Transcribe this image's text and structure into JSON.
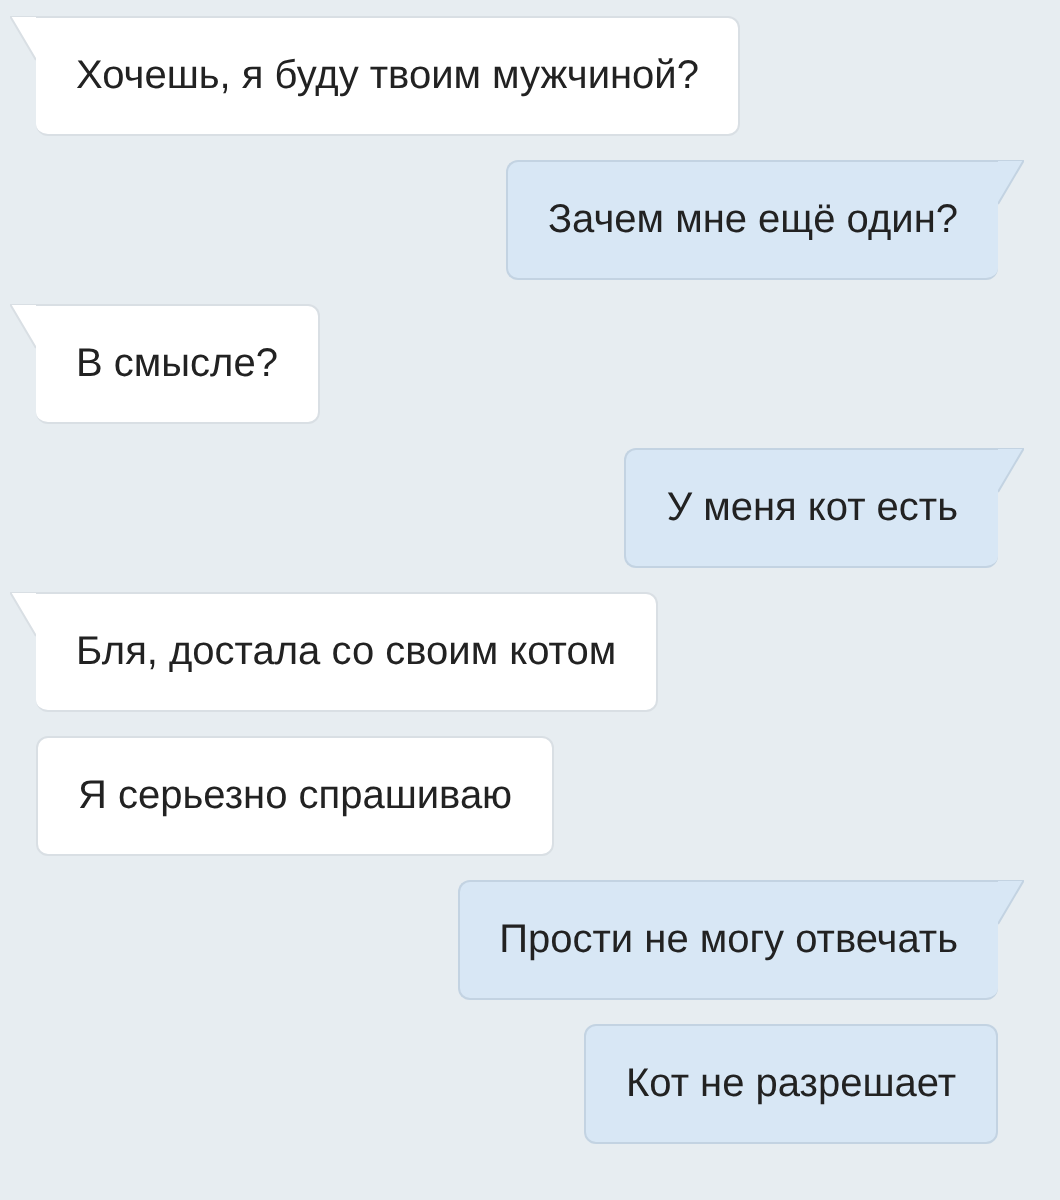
{
  "messages": [
    {
      "kind": "incoming",
      "tail": true,
      "text": "Хочешь, я буду твоим мужчиной?"
    },
    {
      "kind": "outgoing",
      "tail": true,
      "text": "Зачем мне ещё один?"
    },
    {
      "kind": "incoming",
      "tail": true,
      "text": "В смысле?"
    },
    {
      "kind": "outgoing",
      "tail": true,
      "text": "У меня кот есть"
    },
    {
      "kind": "incoming",
      "tail": true,
      "text": "Бля, достала со своим котом"
    },
    {
      "kind": "incoming",
      "tail": false,
      "text": "Я серьезно спрашиваю"
    },
    {
      "kind": "outgoing",
      "tail": true,
      "text": "Прости не могу отвечать"
    },
    {
      "kind": "outgoing",
      "tail": false,
      "text": "Кот не разрешает"
    }
  ]
}
